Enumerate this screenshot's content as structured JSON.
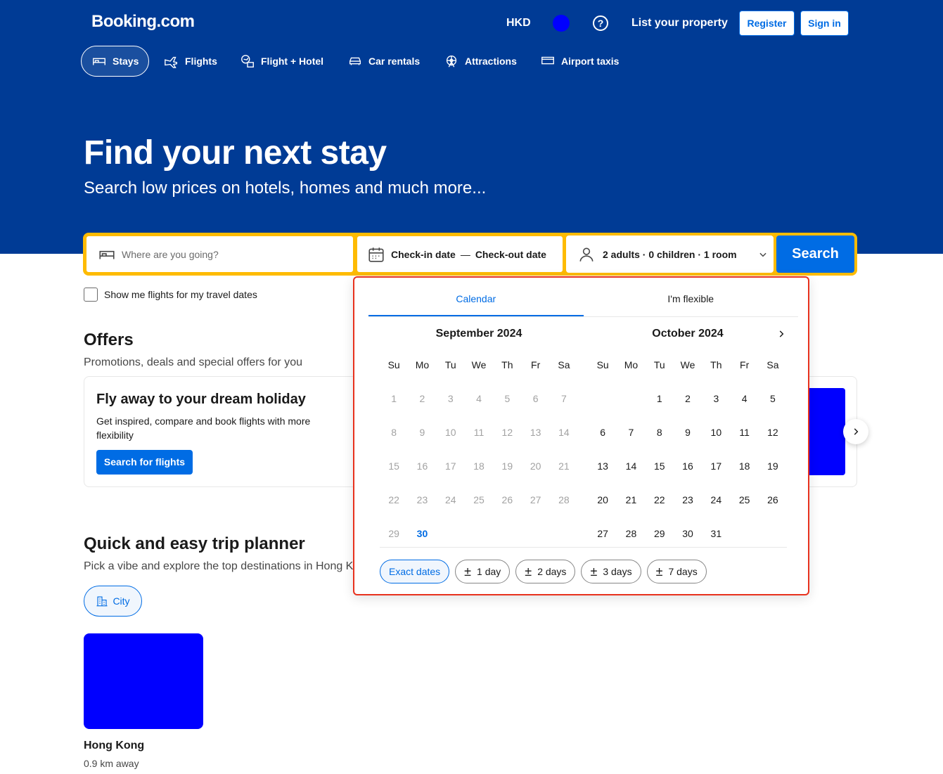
{
  "header": {
    "logo": "Booking.com",
    "currency": "HKD",
    "help": "?",
    "list_property": "List your property",
    "register": "Register",
    "sign_in": "Sign in"
  },
  "nav": {
    "items": [
      {
        "label": "Stays",
        "icon": "bed-icon",
        "active": true
      },
      {
        "label": "Flights",
        "icon": "plane-icon"
      },
      {
        "label": "Flight + Hotel",
        "icon": "flight-hotel-icon"
      },
      {
        "label": "Car rentals",
        "icon": "car-icon"
      },
      {
        "label": "Attractions",
        "icon": "ferris-wheel-icon"
      },
      {
        "label": "Airport taxis",
        "icon": "taxi-icon"
      }
    ]
  },
  "hero": {
    "title": "Find your next stay",
    "subtitle": "Search low prices on hotels, homes and much more..."
  },
  "search": {
    "destination_placeholder": "Where are you going?",
    "checkin": "Check-in date",
    "dash": "—",
    "checkout": "Check-out date",
    "guests": "2 adults · 0 children · 1 room",
    "button": "Search",
    "flights_checkbox": "Show me flights for my travel dates"
  },
  "offers": {
    "title": "Offers",
    "subtitle": "Promotions, deals and special offers for you",
    "card_title": "Fly away to your dream holiday",
    "card_text": "Get inspired, compare and book flights with more flexibility",
    "card_button": "Search for flights"
  },
  "planner": {
    "title": "Quick and easy trip planner",
    "subtitle": "Pick a vibe and explore the top destinations in Hong K",
    "chip": "City",
    "destination": "Hong Kong",
    "distance": "0.9 km away"
  },
  "calendar": {
    "tabs": [
      "Calendar",
      "I'm flexible"
    ],
    "weekdays": [
      "Su",
      "Mo",
      "Tu",
      "We",
      "Th",
      "Fr",
      "Sa"
    ],
    "months": [
      {
        "title": "September 2024",
        "offset": 0,
        "days": 30,
        "past_until": 29,
        "today": 30
      },
      {
        "title": "October 2024",
        "offset": 2,
        "days": 31,
        "past_until": 0,
        "today": 0
      }
    ],
    "chips": [
      {
        "label": "Exact dates",
        "pm": false,
        "active": true
      },
      {
        "label": "1 day",
        "pm": true
      },
      {
        "label": "2 days",
        "pm": true
      },
      {
        "label": "3 days",
        "pm": true
      },
      {
        "label": "7 days",
        "pm": true
      }
    ]
  }
}
